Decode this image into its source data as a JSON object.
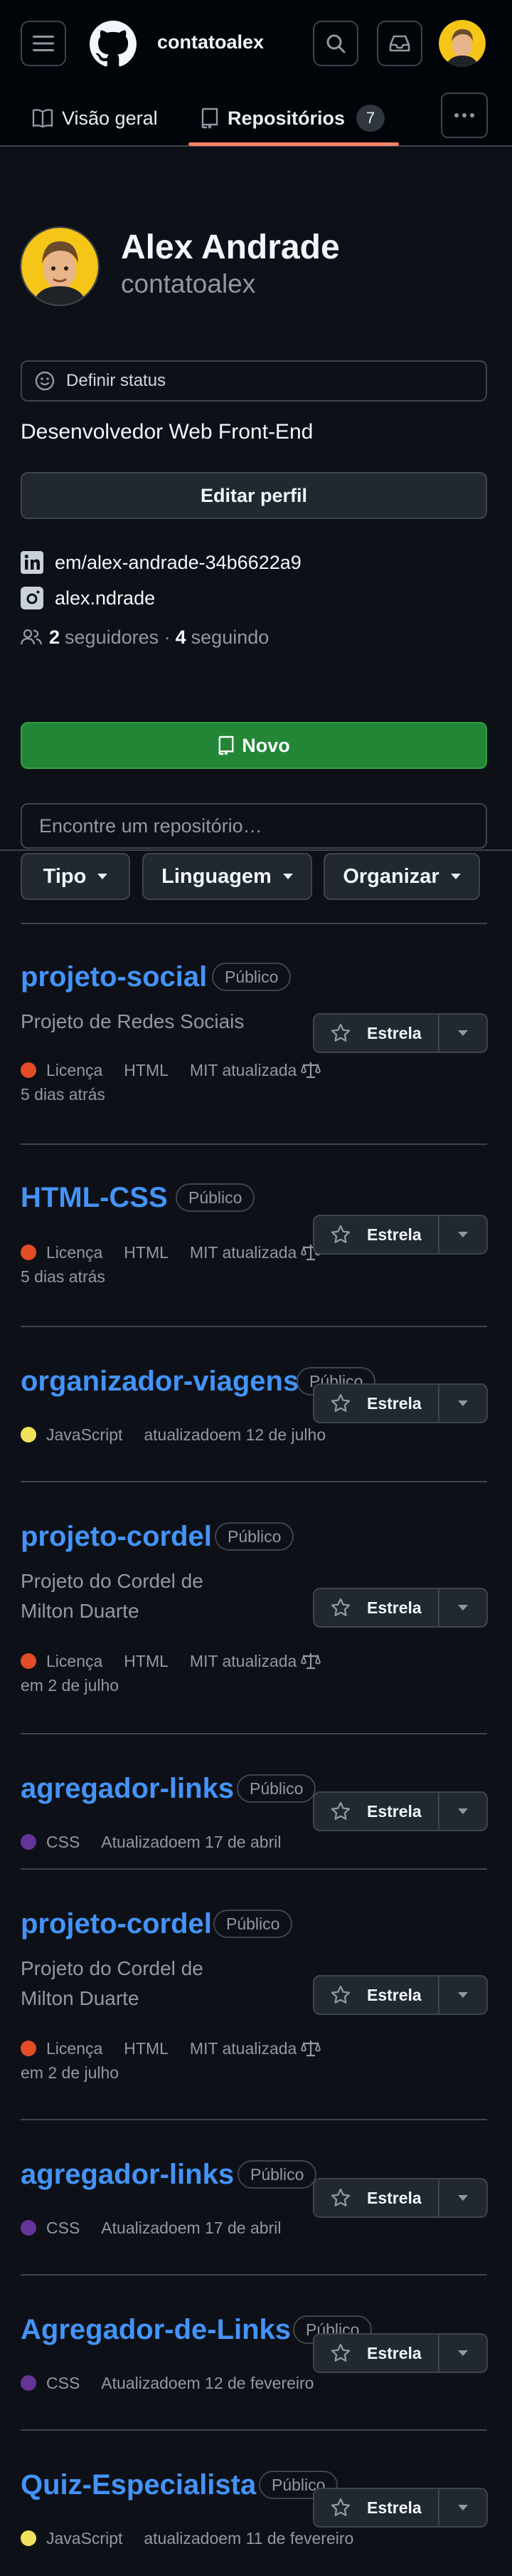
{
  "header": {
    "title": "contatoalex",
    "menu_icon": "hamburger-icon",
    "logo_icon": "github-logo-icon",
    "search_icon": "search-icon",
    "inbox_icon": "inbox-icon"
  },
  "tabs": [
    {
      "label": "Visão geral",
      "icon": "book-icon"
    },
    {
      "label": "Repositórios",
      "icon": "repo-icon",
      "count": "7",
      "active": true
    }
  ],
  "profile": {
    "name": "Alex Andrade",
    "login": "contatoalex",
    "status_label": "Definir status",
    "bio": "Desenvolvedor Web Front-End",
    "edit_label": "Editar perfil",
    "linkedin": "em/alex-andrade-34b6622a9",
    "instagram": "alex.ndrade",
    "followers_count": "2",
    "followers_label": "seguidores ·",
    "following_count": "4",
    "following_label": "seguindo"
  },
  "actions": {
    "new_label": "Novo",
    "search_placeholder": "Encontre um repositório…",
    "filters": [
      "Tipo",
      "Linguagem",
      "Organizar"
    ]
  },
  "colors": {
    "accent_link": "#4493f8",
    "primary_button": "#238636",
    "tab_underline": "#f78166",
    "lang_html": "#e34c26",
    "lang_javascript": "#f1e05a",
    "lang_css": "#663399"
  },
  "star_label": "Estrela",
  "repos": [
    {
      "name": "projeto-social",
      "badge": "Público",
      "desc": [
        "Projeto de Redes Sociais"
      ],
      "meta": [
        "Licença",
        "HTML",
        "MIT atualizada"
      ],
      "meta2": "5 dias atrás"
    },
    {
      "name": "HTML-CSS",
      "badge": "Público",
      "desc": [],
      "meta": [
        "Licença",
        "HTML",
        "MIT atualizada"
      ],
      "meta2": "5 dias atrás"
    },
    {
      "name": "organizador-viagens",
      "badge": "Público",
      "desc": [],
      "meta": [
        "JavaScript",
        "atualizadoem 12 de julho"
      ],
      "meta2": ""
    },
    {
      "name": "projeto-cordel",
      "badge": "Público",
      "desc": [
        "Projeto do Cordel de",
        "Milton Duarte"
      ],
      "meta": [
        "Licença",
        "HTML",
        "MIT atualizada"
      ],
      "meta2": "em 2 de julho"
    },
    {
      "name": "agregador-links",
      "badge": "Público",
      "desc": [],
      "meta": [
        "CSS",
        "Atualizadoem 17 de abril"
      ],
      "meta2": ""
    },
    {
      "name": "projeto-cordel",
      "badge": "Público",
      "desc": [
        "Projeto do Cordel de",
        "Milton Duarte"
      ],
      "meta": [
        "Licença",
        "HTML",
        "MIT atualizada"
      ],
      "meta2": "em 2 de julho"
    },
    {
      "name": "agregador-links",
      "badge": "Público",
      "desc": [],
      "meta": [
        "CSS",
        "Atualizadoem 17 de abril"
      ],
      "meta2": ""
    },
    {
      "name": "Agregador-de-Links",
      "badge": "Público",
      "desc": [],
      "meta": [
        "CSS",
        "Atualizadoem 12 de fevereiro"
      ],
      "meta2": ""
    },
    {
      "name": "Quiz-Especialista",
      "badge": "Público",
      "desc": [],
      "meta": [
        "JavaScript",
        "atualizadoem 11 de fevereiro"
      ],
      "meta2": ""
    }
  ]
}
